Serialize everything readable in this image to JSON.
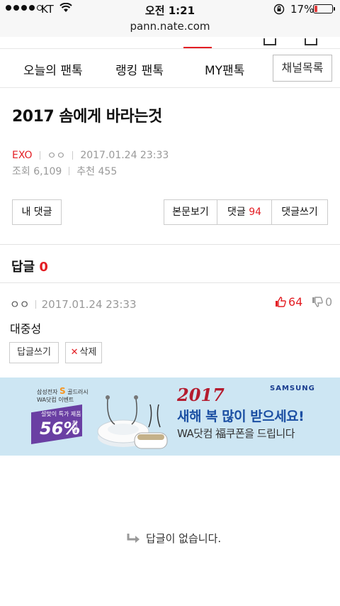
{
  "status": {
    "carrier": "KT",
    "time": "오전 1:21",
    "battery": "17%",
    "battery_level": 0.17
  },
  "browser": {
    "url": "pann.nate.com"
  },
  "tabs": [
    {
      "label": "오늘의 팬톡"
    },
    {
      "label": "랭킹 팬톡"
    },
    {
      "label": "MY팬톡"
    }
  ],
  "channel_button": "채널목록",
  "post": {
    "title": "2017 솜에게 바라는것",
    "category": "EXO",
    "author": "ㅇㅇ",
    "date": "2017.01.24 23:33",
    "views": "조회 6,109",
    "recommends": "추천 455"
  },
  "actions": {
    "my_comments": "내 댓글",
    "view_post": "본문보기",
    "comments_label": "댓글",
    "comments_count": "94",
    "write_comment": "댓글쓰기"
  },
  "replies": {
    "label": "답글",
    "count": "0"
  },
  "comment": {
    "author": "ㅇㅇ",
    "date": "2017.01.24 23:33",
    "likes": "64",
    "dislikes": "0",
    "body": "대중성",
    "reply_button": "답글쓰기",
    "delete_button": "삭제"
  },
  "banner": {
    "brand": "삼성전자",
    "brand_s": "S",
    "brand_suffix": "골드러시",
    "event": "WA닷컴 이벤트",
    "promo_line": "설맞이 특가 제품",
    "promo_pct": "56%",
    "promo_max": "최대",
    "year": "2017",
    "samsung": "SAMSUNG",
    "headline": "새해 복 많이 받으세요!",
    "subline": "WA닷컴 福쿠폰을 드립니다"
  },
  "empty_message": "답글이 없습니다."
}
